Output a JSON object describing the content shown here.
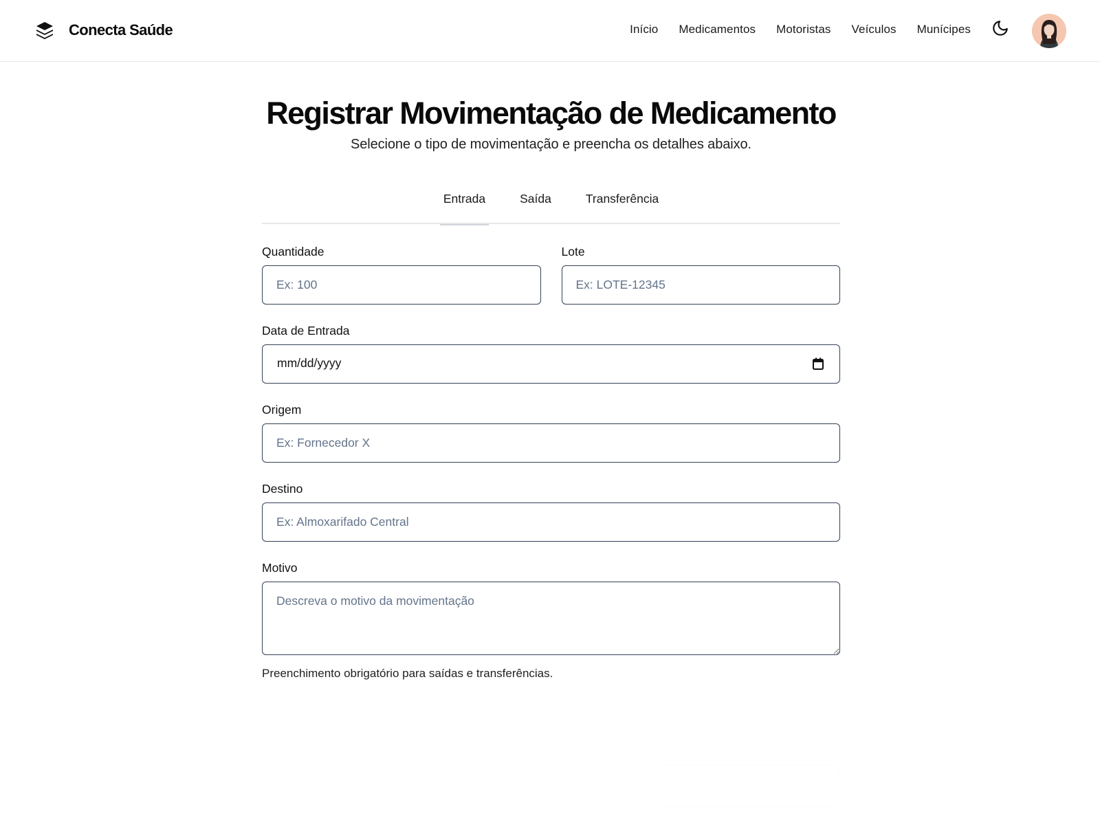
{
  "brand": {
    "name": "Conecta Saúde",
    "logo_icon": "layers-icon"
  },
  "nav": {
    "items": [
      {
        "label": "Início"
      },
      {
        "label": "Medicamentos"
      },
      {
        "label": "Motoristas"
      },
      {
        "label": "Veículos"
      },
      {
        "label": "Munícipes"
      }
    ],
    "theme_icon": "moon-icon"
  },
  "page": {
    "title": "Registrar Movimentação de Medicamento",
    "subtitle": "Selecione o tipo de movimentação e preencha os detalhes abaixo."
  },
  "tabs": [
    {
      "label": "Entrada",
      "active": true
    },
    {
      "label": "Saída",
      "active": false
    },
    {
      "label": "Transferência",
      "active": false
    }
  ],
  "form": {
    "quantidade": {
      "label": "Quantidade",
      "placeholder": "Ex: 100"
    },
    "lote": {
      "label": "Lote",
      "placeholder": "Ex: LOTE-12345"
    },
    "data": {
      "label": "Data de Entrada",
      "value": "mm/dd/yyyy"
    },
    "origem": {
      "label": "Origem",
      "placeholder": "Ex: Fornecedor X"
    },
    "destino": {
      "label": "Destino",
      "placeholder": "Ex: Almoxarifado Central"
    },
    "motivo": {
      "label": "Motivo",
      "placeholder": "Descreva o motivo da movimentação",
      "helper": "Preenchimento obrigatório para saídas e transferências."
    }
  },
  "colors": {
    "input_border": "#334155",
    "placeholder": "#64748b",
    "avatar_bg": "#f6c7b0"
  }
}
